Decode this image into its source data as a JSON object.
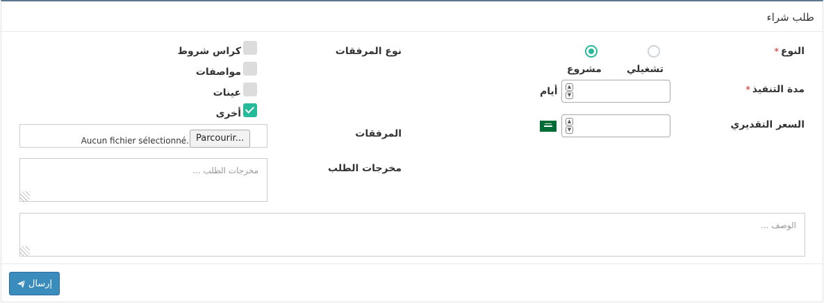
{
  "panel": {
    "title": "طلب شراء"
  },
  "type": {
    "label": "النوع",
    "required_mark": "*",
    "options": [
      {
        "label": "تشغيلي",
        "selected": false
      },
      {
        "label": "مشروع",
        "selected": true
      }
    ]
  },
  "duration": {
    "label": "مدة التنفيذ",
    "required_mark": "*",
    "value": "",
    "unit": "أيام"
  },
  "price": {
    "label": "السعر التقديري",
    "value": "",
    "currency_flag": "sa-flag-icon"
  },
  "attachment_type": {
    "label": "نوع المرفقات",
    "options": [
      {
        "label": "كراس شروط",
        "checked": false
      },
      {
        "label": "مواصفات",
        "checked": false
      },
      {
        "label": "عينات",
        "checked": false
      },
      {
        "label": "أخرى",
        "checked": true
      }
    ]
  },
  "attachments": {
    "label": "المرفقات",
    "browse_label": "Parcourir...",
    "status": "Aucun fichier sélectionné."
  },
  "outputs": {
    "label": "مخرجات الطلب",
    "placeholder": "مخرجات الطلب ..."
  },
  "description": {
    "placeholder": "الوصف ..."
  },
  "submit": {
    "label": "إرسال",
    "icon": "paper-plane-icon"
  },
  "colors": {
    "accent": "#26b99a",
    "button": "#3a8cbd",
    "required": "#d9534f"
  }
}
